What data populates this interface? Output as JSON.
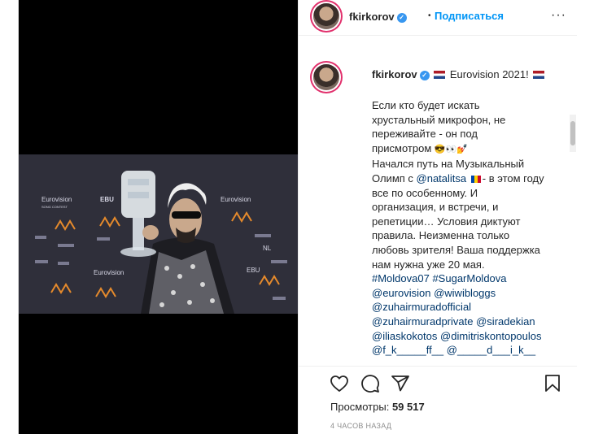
{
  "post": {
    "username": "fkirkorov",
    "dot": "•",
    "subscribe_label": "Подписаться",
    "more_label": "···"
  },
  "photo": {
    "backdrop_logo_main": "Eurovision",
    "backdrop_logo_sub": "SONG CONTEST",
    "backdrop_ebu": "EBU",
    "backdrop_nl": "NL"
  },
  "caption": {
    "username": "fkirkorov",
    "headline": "Eurovision 2021!",
    "lines": [
      "Если кто будет искать",
      "хрустальный микрофон, не",
      "переживайте - он под",
      "присмотром"
    ],
    "emoji_after_watch": "😎👀💅",
    "line_path_1": "Начался путь на Музыкальный",
    "line_path_2a": "Олимп с ",
    "mention_natalitsa": "@natalitsa",
    "line_path_2b": "- в этом году",
    "rest_lines": [
      "все по особенному. И",
      "организация, и встречи, и",
      "репетиции… Условия диктуют",
      "правила. Неизменна только",
      "любовь зрителя! Ваша поддержка",
      "нам нужна уже 20 мая."
    ],
    "hashtag_1": "#Moldova07",
    "hashtag_2": "#SugarMoldova",
    "mention_eurovision": "@eurovision",
    "mention_wiwibloggs": "@wiwibloggs",
    "mention_zuhair": "@zuhairmuradofficial",
    "mention_zuhair_private": "@zuhairmuradprivate",
    "mention_siradekian": "@siradekian",
    "mention_iliaskokotos": "@iliaskokotos",
    "mention_dimitris": "@dimitriskontopoulos",
    "cut_line": "@f_k_____ff__ @_____d___i_k__"
  },
  "stats": {
    "views_label": "Просмотры:",
    "views_value": "59 517",
    "time_ago": "4 часов назад"
  },
  "icons": {
    "like": "heart-icon",
    "comment": "comment-icon",
    "share": "paper-plane-icon",
    "save": "bookmark-icon"
  }
}
